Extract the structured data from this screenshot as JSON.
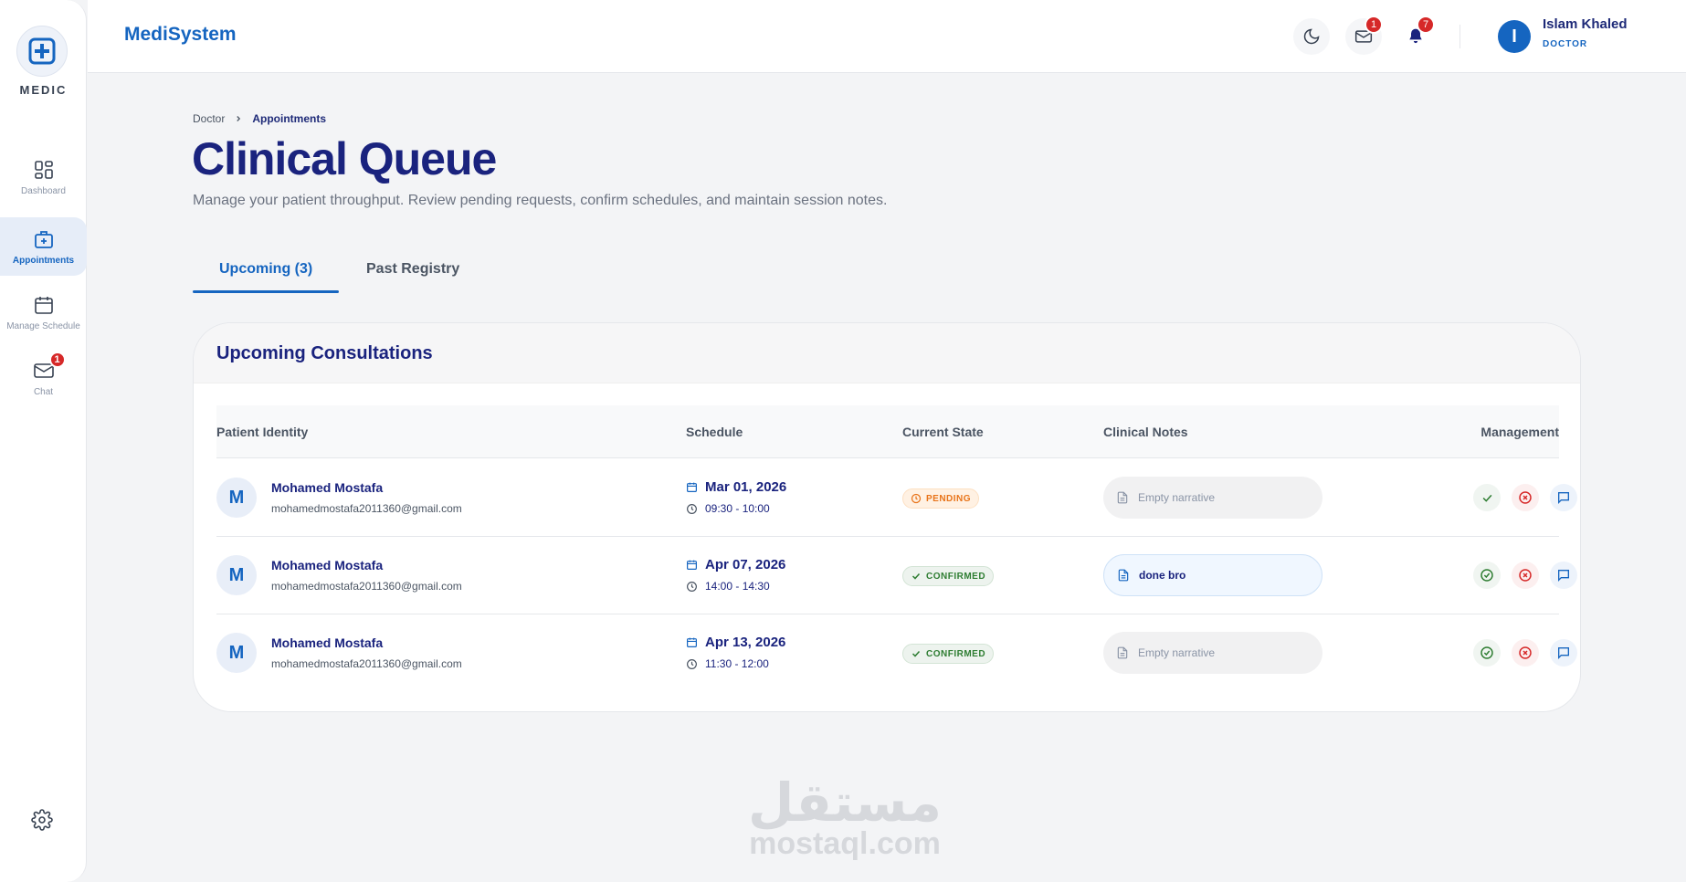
{
  "sidebar": {
    "logo_text": "MEDIC",
    "items": [
      {
        "label": "Dashboard",
        "icon": "dashboard-grid-icon"
      },
      {
        "label": "Appointments",
        "icon": "medical-bag-icon",
        "active": true
      },
      {
        "label": "Manage Schedule",
        "icon": "calendar-icon"
      },
      {
        "label": "Chat",
        "icon": "mail-icon",
        "badge": "1"
      }
    ],
    "settings_icon": "gear-icon"
  },
  "header": {
    "brand": "MediSystem",
    "messages_badge": "1",
    "notifications_badge": "7",
    "user": {
      "initial": "I",
      "name": "Islam Khaled",
      "role": "DOCTOR"
    }
  },
  "breadcrumb": {
    "root": "Doctor",
    "current": "Appointments"
  },
  "page": {
    "title": "Clinical Queue",
    "subtitle": "Manage your patient throughput. Review pending requests, confirm schedules, and maintain session notes."
  },
  "tabs": [
    {
      "label": "Upcoming (3)",
      "active": true
    },
    {
      "label": "Past Registry",
      "active": false
    }
  ],
  "card": {
    "title": "Upcoming Consultations",
    "columns": [
      "Patient Identity",
      "Schedule",
      "Current State",
      "Clinical Notes",
      "Management"
    ],
    "rows": [
      {
        "initial": "M",
        "name": "Mohamed Mostafa",
        "email": "mohamedmostafa2011360@gmail.com",
        "date": "Mar 01, 2026",
        "time": "09:30 - 10:00",
        "status": "PENDING",
        "note": "Empty narrative"
      },
      {
        "initial": "M",
        "name": "Mohamed Mostafa",
        "email": "mohamedmostafa2011360@gmail.com",
        "date": "Apr 07, 2026",
        "time": "14:00 - 14:30",
        "status": "CONFIRMED",
        "note": "done bro"
      },
      {
        "initial": "M",
        "name": "Mohamed Mostafa",
        "email": "mohamedmostafa2011360@gmail.com",
        "date": "Apr 13, 2026",
        "time": "11:30 - 12:00",
        "status": "CONFIRMED",
        "note": "Empty narrative"
      }
    ]
  },
  "watermark": {
    "arabic": "مستقل",
    "latin": "mostaql.com"
  },
  "colors": {
    "primary": "#1565c0",
    "navy": "#1a237e",
    "pending": "#e8741a",
    "confirmed": "#2e7d32",
    "danger": "#d62828"
  }
}
